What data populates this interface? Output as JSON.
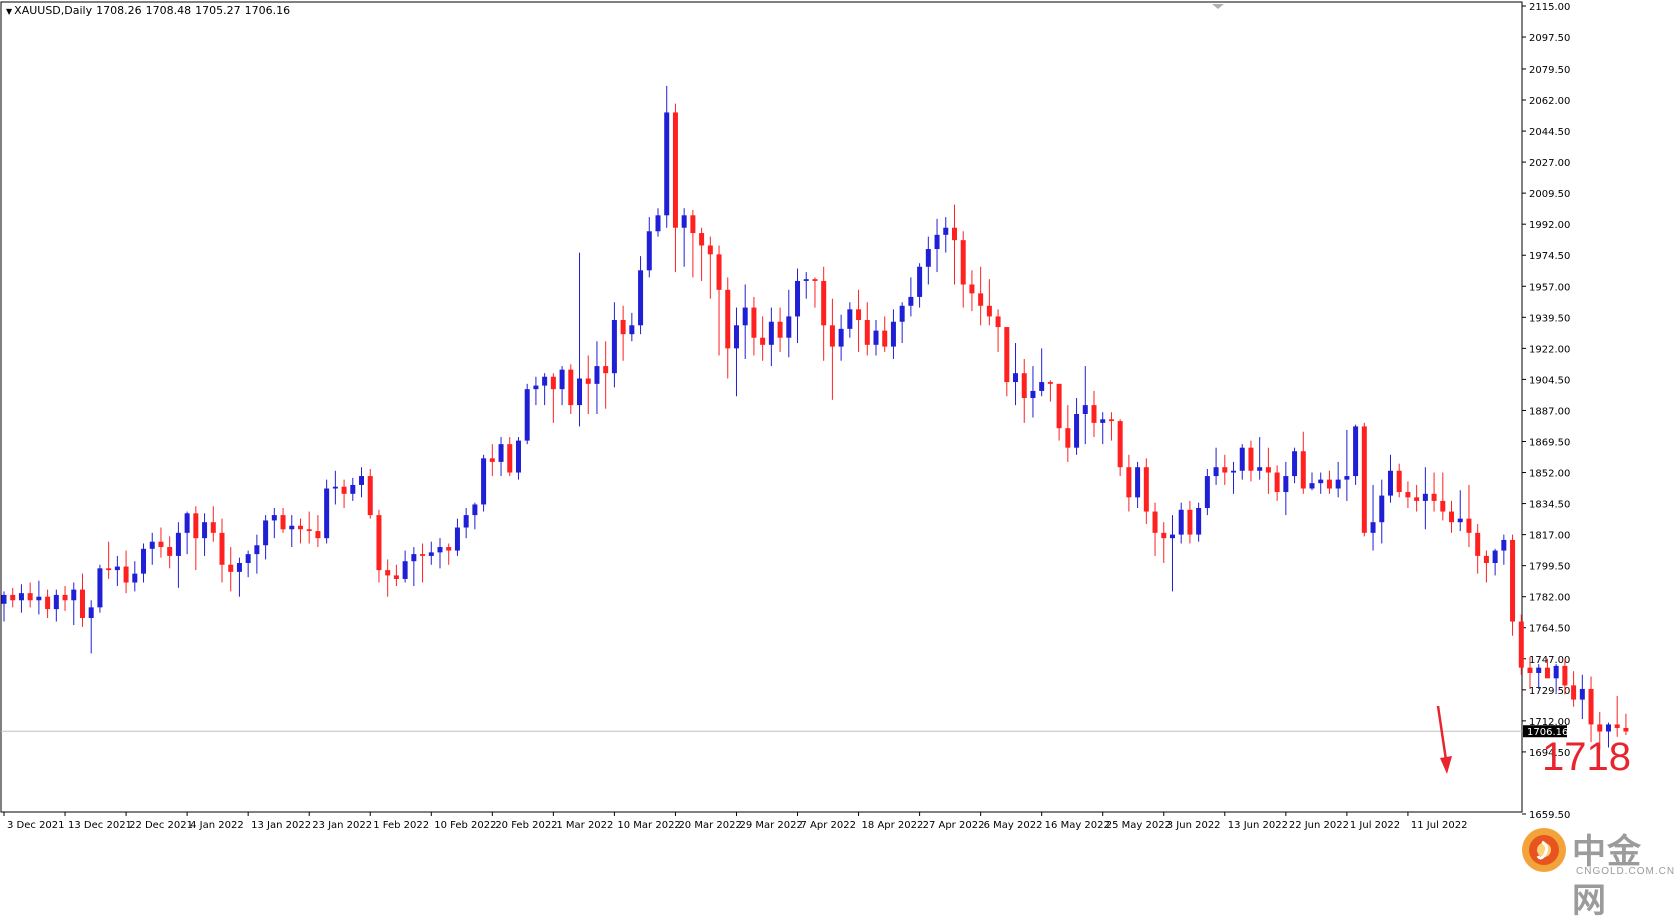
{
  "header": {
    "symbol": "XAUUSD,Daily",
    "open": "1708.26",
    "high": "1708.48",
    "low": "1705.27",
    "close": "1706.16"
  },
  "annotation": "1718",
  "watermark": {
    "name": "中金网",
    "site": "CNGOLD.COM.CN"
  },
  "colors": {
    "bull": "#1f1fd6",
    "bear": "#ff2020",
    "background": "#ffffff",
    "axis": "#000000",
    "annotation": "#e8252d",
    "current_price_line": "#c0c0c0"
  },
  "chart_data": {
    "type": "candlestick",
    "symbol": "XAUUSD",
    "timeframe": "Daily",
    "ylim": [
      1659.5,
      2115
    ],
    "y_ticks": [
      "2115.00",
      "2097.50",
      "2079.50",
      "2062.00",
      "2044.50",
      "2027.00",
      "2009.50",
      "1992.00",
      "1974.50",
      "1957.00",
      "1939.50",
      "1922.00",
      "1904.50",
      "1887.00",
      "1869.50",
      "1852.00",
      "1834.50",
      "1817.00",
      "1799.50",
      "1782.00",
      "1764.50",
      "1747.00",
      "1729.50",
      "1712.00",
      "1694.50",
      "1659.50"
    ],
    "x_tick_labels": [
      {
        "index": 0,
        "label": "3 Dec 2021"
      },
      {
        "index": 7,
        "label": "13 Dec 2021"
      },
      {
        "index": 14,
        "label": "22 Dec 2021"
      },
      {
        "index": 21,
        "label": "4 Jan 2022"
      },
      {
        "index": 28,
        "label": "13 Jan 2022"
      },
      {
        "index": 35,
        "label": "23 Jan 2022"
      },
      {
        "index": 42,
        "label": "1 Feb 2022"
      },
      {
        "index": 49,
        "label": "10 Feb 2022"
      },
      {
        "index": 56,
        "label": "20 Feb 2022"
      },
      {
        "index": 63,
        "label": "1 Mar 2022"
      },
      {
        "index": 70,
        "label": "10 Mar 2022"
      },
      {
        "index": 77,
        "label": "20 Mar 2022"
      },
      {
        "index": 84,
        "label": "29 Mar 2022"
      },
      {
        "index": 91,
        "label": "7 Apr 2022"
      },
      {
        "index": 98,
        "label": "18 Apr 2022"
      },
      {
        "index": 105,
        "label": "27 Apr 2022"
      },
      {
        "index": 112,
        "label": "6 May 2022"
      },
      {
        "index": 119,
        "label": "16 May 2022"
      },
      {
        "index": 126,
        "label": "25 May 2022"
      },
      {
        "index": 133,
        "label": "3 Jun 2022"
      },
      {
        "index": 140,
        "label": "13 Jun 2022"
      },
      {
        "index": 147,
        "label": "22 Jun 2022"
      },
      {
        "index": 154,
        "label": "1 Jul 2022"
      },
      {
        "index": 161,
        "label": "11 Jul 2022"
      }
    ],
    "current_price": 1706.16,
    "current_price_label": "1706.16",
    "candles": [
      [
        1778,
        1785,
        1768,
        1783
      ],
      [
        1783,
        1787,
        1776,
        1780
      ],
      [
        1780,
        1789,
        1773,
        1784
      ],
      [
        1784,
        1790,
        1776,
        1780
      ],
      [
        1780,
        1791,
        1772,
        1782
      ],
      [
        1782,
        1786,
        1770,
        1775
      ],
      [
        1775,
        1786,
        1768,
        1783
      ],
      [
        1783,
        1788,
        1774,
        1780
      ],
      [
        1780,
        1790,
        1766,
        1786
      ],
      [
        1786,
        1795,
        1765,
        1770
      ],
      [
        1770,
        1780,
        1750,
        1776
      ],
      [
        1776,
        1800,
        1773,
        1798
      ],
      [
        1798,
        1813,
        1792,
        1797
      ],
      [
        1797,
        1805,
        1788,
        1799
      ],
      [
        1799,
        1808,
        1784,
        1790
      ],
      [
        1790,
        1802,
        1785,
        1795
      ],
      [
        1795,
        1812,
        1790,
        1809
      ],
      [
        1809,
        1818,
        1800,
        1813
      ],
      [
        1813,
        1821,
        1804,
        1810
      ],
      [
        1810,
        1816,
        1798,
        1805
      ],
      [
        1805,
        1824,
        1787,
        1818
      ],
      [
        1818,
        1830,
        1806,
        1829
      ],
      [
        1829,
        1833,
        1797,
        1815
      ],
      [
        1815,
        1829,
        1805,
        1824
      ],
      [
        1824,
        1833,
        1813,
        1818
      ],
      [
        1818,
        1826,
        1790,
        1800
      ],
      [
        1800,
        1810,
        1785,
        1796
      ],
      [
        1796,
        1804,
        1782,
        1801
      ],
      [
        1801,
        1808,
        1793,
        1806
      ],
      [
        1806,
        1817,
        1795,
        1811
      ],
      [
        1811,
        1828,
        1803,
        1825
      ],
      [
        1825,
        1832,
        1815,
        1828
      ],
      [
        1828,
        1832,
        1818,
        1820
      ],
      [
        1820,
        1828,
        1810,
        1822
      ],
      [
        1822,
        1826,
        1812,
        1820
      ],
      [
        1820,
        1830,
        1812,
        1819
      ],
      [
        1819,
        1828,
        1810,
        1815
      ],
      [
        1815,
        1848,
        1812,
        1843
      ],
      [
        1843,
        1853,
        1834,
        1844
      ],
      [
        1844,
        1848,
        1832,
        1840
      ],
      [
        1840,
        1849,
        1836,
        1845
      ],
      [
        1845,
        1855,
        1838,
        1850
      ],
      [
        1850,
        1854,
        1826,
        1828
      ],
      [
        1828,
        1831,
        1790,
        1797
      ],
      [
        1797,
        1803,
        1782,
        1794
      ],
      [
        1794,
        1800,
        1788,
        1792
      ],
      [
        1792,
        1808,
        1790,
        1802
      ],
      [
        1802,
        1810,
        1788,
        1806
      ],
      [
        1806,
        1812,
        1790,
        1805
      ],
      [
        1805,
        1813,
        1800,
        1807
      ],
      [
        1807,
        1815,
        1798,
        1810
      ],
      [
        1810,
        1812,
        1800,
        1808
      ],
      [
        1808,
        1826,
        1805,
        1821
      ],
      [
        1821,
        1832,
        1815,
        1828
      ],
      [
        1828,
        1835,
        1820,
        1834
      ],
      [
        1834,
        1862,
        1830,
        1860
      ],
      [
        1860,
        1868,
        1850,
        1858
      ],
      [
        1858,
        1872,
        1850,
        1868
      ],
      [
        1868,
        1872,
        1850,
        1852
      ],
      [
        1852,
        1872,
        1848,
        1870
      ],
      [
        1870,
        1902,
        1868,
        1899
      ],
      [
        1899,
        1906,
        1890,
        1901
      ],
      [
        1901,
        1908,
        1890,
        1906
      ],
      [
        1906,
        1908,
        1880,
        1899
      ],
      [
        1899,
        1912,
        1890,
        1910
      ],
      [
        1910,
        1913,
        1885,
        1890
      ],
      [
        1890,
        1976,
        1878,
        1905
      ],
      [
        1905,
        1918,
        1885,
        1902
      ],
      [
        1902,
        1926,
        1885,
        1912
      ],
      [
        1912,
        1926,
        1888,
        1908
      ],
      [
        1908,
        1948,
        1900,
        1938
      ],
      [
        1938,
        1946,
        1915,
        1930
      ],
      [
        1930,
        1942,
        1926,
        1935
      ],
      [
        1935,
        1974,
        1930,
        1966
      ],
      [
        1966,
        1996,
        1962,
        1988
      ],
      [
        1988,
        2001,
        1985,
        1997
      ],
      [
        1997,
        2070,
        1990,
        2055
      ],
      [
        2055,
        2060,
        1965,
        1990
      ],
      [
        1990,
        2001,
        1968,
        1997
      ],
      [
        1997,
        2000,
        1962,
        1987
      ],
      [
        1987,
        1990,
        1960,
        1980
      ],
      [
        1980,
        1985,
        1950,
        1975
      ],
      [
        1975,
        1980,
        1918,
        1955
      ],
      [
        1955,
        1962,
        1905,
        1922
      ],
      [
        1922,
        1945,
        1895,
        1935
      ],
      [
        1935,
        1958,
        1916,
        1945
      ],
      [
        1945,
        1951,
        1918,
        1928
      ],
      [
        1928,
        1940,
        1915,
        1924
      ],
      [
        1924,
        1945,
        1912,
        1937
      ],
      [
        1937,
        1945,
        1920,
        1928
      ],
      [
        1928,
        1955,
        1917,
        1940
      ],
      [
        1940,
        1967,
        1925,
        1960
      ],
      [
        1960,
        1965,
        1950,
        1961
      ],
      [
        1961,
        1962,
        1945,
        1960
      ],
      [
        1960,
        1968,
        1915,
        1935
      ],
      [
        1935,
        1950,
        1893,
        1923
      ],
      [
        1923,
        1941,
        1915,
        1933
      ],
      [
        1933,
        1948,
        1928,
        1944
      ],
      [
        1944,
        1955,
        1920,
        1938
      ],
      [
        1938,
        1948,
        1918,
        1924
      ],
      [
        1924,
        1938,
        1918,
        1932
      ],
      [
        1932,
        1940,
        1920,
        1923
      ],
      [
        1923,
        1944,
        1916,
        1937
      ],
      [
        1937,
        1948,
        1925,
        1946
      ],
      [
        1946,
        1962,
        1940,
        1951
      ],
      [
        1951,
        1970,
        1945,
        1968
      ],
      [
        1968,
        1985,
        1958,
        1978
      ],
      [
        1978,
        1995,
        1965,
        1986
      ],
      [
        1986,
        1996,
        1976,
        1990
      ],
      [
        1990,
        2003,
        1958,
        1983
      ],
      [
        1983,
        1988,
        1945,
        1958
      ],
      [
        1958,
        1966,
        1943,
        1953
      ],
      [
        1953,
        1968,
        1935,
        1946
      ],
      [
        1946,
        1961,
        1935,
        1940
      ],
      [
        1940,
        1944,
        1920,
        1934
      ],
      [
        1934,
        1934,
        1895,
        1903
      ],
      [
        1903,
        1925,
        1890,
        1908
      ],
      [
        1908,
        1916,
        1880,
        1894
      ],
      [
        1894,
        1912,
        1883,
        1898
      ],
      [
        1898,
        1922,
        1895,
        1903
      ],
      [
        1903,
        1904,
        1892,
        1902
      ],
      [
        1902,
        1902,
        1870,
        1877
      ],
      [
        1877,
        1890,
        1858,
        1866
      ],
      [
        1866,
        1894,
        1862,
        1885
      ],
      [
        1885,
        1912,
        1868,
        1890
      ],
      [
        1890,
        1898,
        1872,
        1880
      ],
      [
        1880,
        1886,
        1868,
        1882
      ],
      [
        1882,
        1886,
        1870,
        1881
      ],
      [
        1881,
        1882,
        1850,
        1855
      ],
      [
        1855,
        1862,
        1830,
        1838
      ],
      [
        1838,
        1858,
        1832,
        1855
      ],
      [
        1855,
        1860,
        1823,
        1830
      ],
      [
        1830,
        1835,
        1805,
        1818
      ],
      [
        1818,
        1824,
        1801,
        1815
      ],
      [
        1815,
        1828,
        1785,
        1817
      ],
      [
        1817,
        1835,
        1812,
        1831
      ],
      [
        1831,
        1836,
        1812,
        1817
      ],
      [
        1817,
        1835,
        1813,
        1832
      ],
      [
        1832,
        1854,
        1828,
        1850
      ],
      [
        1850,
        1866,
        1845,
        1855
      ],
      [
        1855,
        1862,
        1845,
        1852
      ],
      [
        1852,
        1858,
        1840,
        1853
      ],
      [
        1853,
        1868,
        1848,
        1866
      ],
      [
        1866,
        1870,
        1847,
        1853
      ],
      [
        1853,
        1872,
        1848,
        1855
      ],
      [
        1855,
        1866,
        1840,
        1852
      ],
      [
        1852,
        1856,
        1836,
        1841
      ],
      [
        1841,
        1858,
        1828,
        1850
      ],
      [
        1850,
        1866,
        1846,
        1864
      ],
      [
        1864,
        1875,
        1840,
        1843
      ],
      [
        1843,
        1852,
        1842,
        1846
      ],
      [
        1846,
        1852,
        1840,
        1848
      ],
      [
        1848,
        1853,
        1840,
        1843
      ],
      [
        1843,
        1858,
        1838,
        1848
      ],
      [
        1848,
        1876,
        1836,
        1850
      ],
      [
        1850,
        1879,
        1845,
        1878
      ],
      [
        1878,
        1880,
        1816,
        1818
      ],
      [
        1818,
        1845,
        1808,
        1824
      ],
      [
        1824,
        1848,
        1812,
        1839
      ],
      [
        1839,
        1862,
        1835,
        1853
      ],
      [
        1853,
        1857,
        1838,
        1841
      ],
      [
        1841,
        1847,
        1832,
        1838
      ],
      [
        1838,
        1845,
        1830,
        1836
      ],
      [
        1836,
        1855,
        1820,
        1840
      ],
      [
        1840,
        1852,
        1830,
        1836
      ],
      [
        1836,
        1852,
        1825,
        1830
      ],
      [
        1830,
        1836,
        1818,
        1824
      ],
      [
        1824,
        1842,
        1819,
        1826
      ],
      [
        1826,
        1845,
        1810,
        1818
      ],
      [
        1818,
        1823,
        1795,
        1805
      ],
      [
        1805,
        1808,
        1790,
        1801
      ],
      [
        1801,
        1809,
        1794,
        1808
      ],
      [
        1808,
        1817,
        1800,
        1814
      ],
      [
        1814,
        1817,
        1760,
        1768
      ],
      [
        1768,
        1772,
        1738,
        1742
      ],
      [
        1742,
        1748,
        1730,
        1739
      ],
      [
        1739,
        1744,
        1730,
        1742
      ],
      [
        1742,
        1747,
        1736,
        1736
      ],
      [
        1736,
        1744,
        1728,
        1743
      ],
      [
        1743,
        1747,
        1727,
        1732
      ],
      [
        1732,
        1740,
        1720,
        1724
      ],
      [
        1724,
        1738,
        1713,
        1730
      ],
      [
        1730,
        1737,
        1700,
        1710
      ],
      [
        1710,
        1717,
        1696,
        1706
      ],
      [
        1706,
        1711,
        1697,
        1710
      ],
      [
        1710,
        1726,
        1703,
        1708
      ],
      [
        1708,
        1716,
        1704,
        1706
      ]
    ]
  }
}
